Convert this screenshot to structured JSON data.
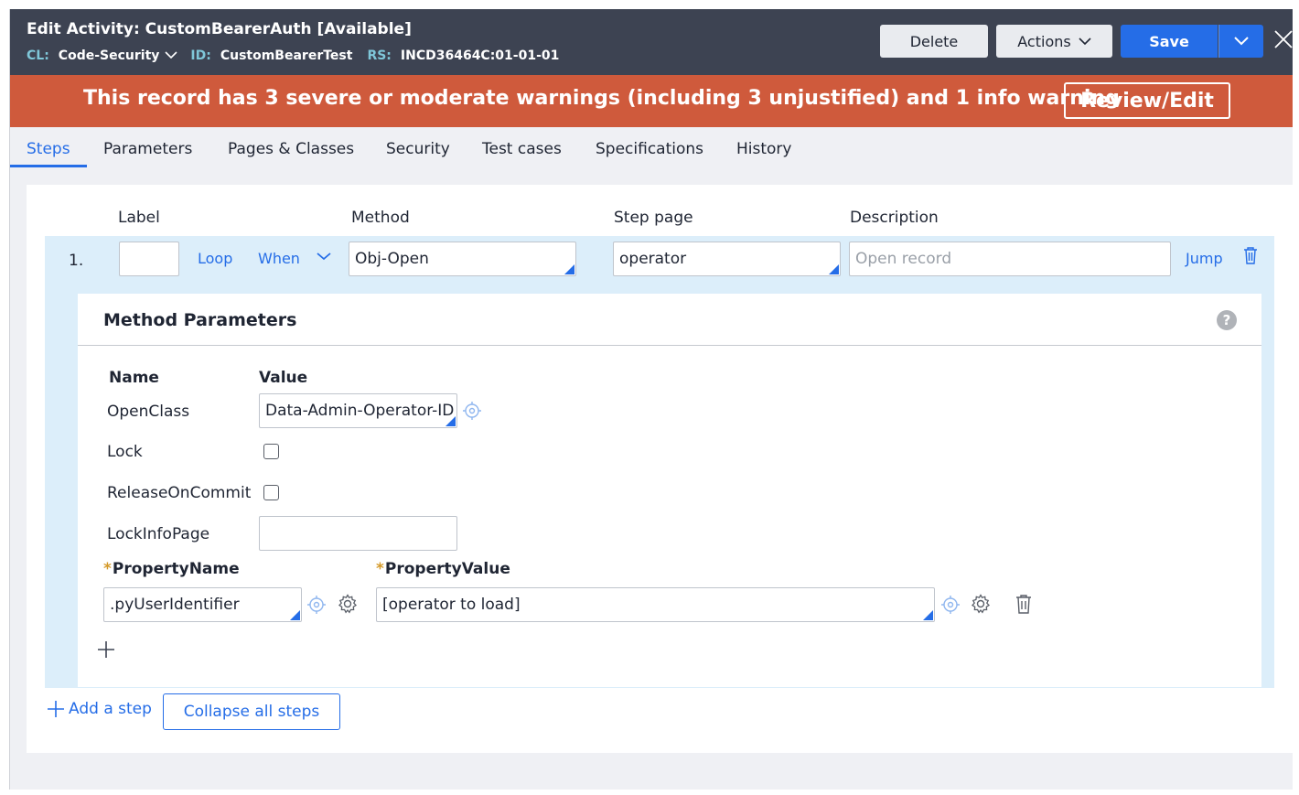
{
  "header": {
    "title": "Edit  Activity: CustomBearerAuth [Available]",
    "cl_key": "CL:",
    "cl_value": "Code-Security",
    "id_key": "ID:",
    "id_value": "CustomBearerTest",
    "rs_key": "RS:",
    "rs_value": "INCD36464C:01-01-01",
    "delete_label": "Delete",
    "actions_label": "Actions",
    "save_label": "Save"
  },
  "banner": {
    "message": "This record has 3 severe or moderate warnings (including 3 unjustified) and 1 info warning",
    "review_label": "Review/Edit",
    "color": "#cf5a3c"
  },
  "tabs": [
    {
      "label": "Steps",
      "active": true
    },
    {
      "label": "Parameters"
    },
    {
      "label": "Pages & Classes"
    },
    {
      "label": "Security"
    },
    {
      "label": "Test cases"
    },
    {
      "label": "Specifications"
    },
    {
      "label": "History"
    }
  ],
  "columns": {
    "label": "Label",
    "method": "Method",
    "step_page": "Step page",
    "description": "Description"
  },
  "step": {
    "number": "1.",
    "label_value": "",
    "loop_label": "Loop",
    "when_label": "When",
    "method_value": "Obj-Open",
    "step_page_value": "operator",
    "description_placeholder": "Open record",
    "jump_label": "Jump"
  },
  "method_parameters": {
    "title": "Method Parameters",
    "name_header": "Name",
    "value_header": "Value",
    "rows": [
      {
        "name": "OpenClass",
        "value": "Data-Admin-Operator-ID"
      },
      {
        "name": "Lock",
        "checked": false
      },
      {
        "name": "ReleaseOnCommit",
        "checked": false
      },
      {
        "name": "LockInfoPage",
        "value": ""
      }
    ],
    "property_name_header": "PropertyName",
    "property_value_header": "PropertyValue",
    "property_name_value": ".pyUserIdentifier",
    "property_value_value": "[operator to load]"
  },
  "footer": {
    "add_step_label": "Add a step",
    "collapse_label": "Collapse all steps"
  },
  "colors": {
    "accent": "#256de7",
    "header_bg": "#3d4352",
    "step_bg": "#dceefa"
  }
}
